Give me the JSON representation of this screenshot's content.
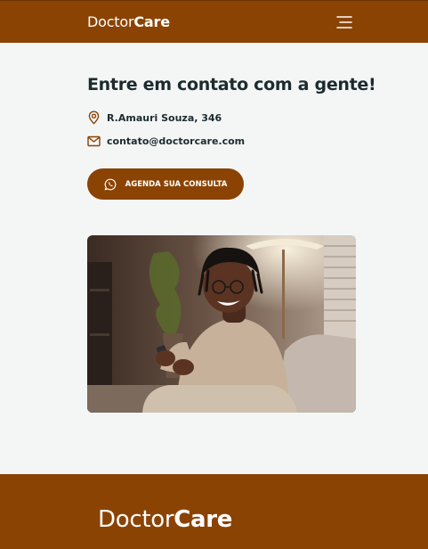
{
  "header": {
    "logo_regular": "Doctor",
    "logo_bold": "Care",
    "menu_icon": "hamburger-menu-icon"
  },
  "contact": {
    "title": "Entre em contato com a gente!",
    "address": "R.Amauri Souza, 346",
    "email": "contato@doctorcare.com",
    "cta_label": "AGENDA SUA CONSULTA",
    "address_icon": "map-pin-icon",
    "email_icon": "mail-icon",
    "cta_icon": "whatsapp-icon"
  },
  "footer": {
    "logo_regular": "Doctor",
    "logo_bold": "Care"
  },
  "colors": {
    "brand": "#8a4303",
    "background": "#f4f6f6",
    "text": "#1c2b2e"
  }
}
